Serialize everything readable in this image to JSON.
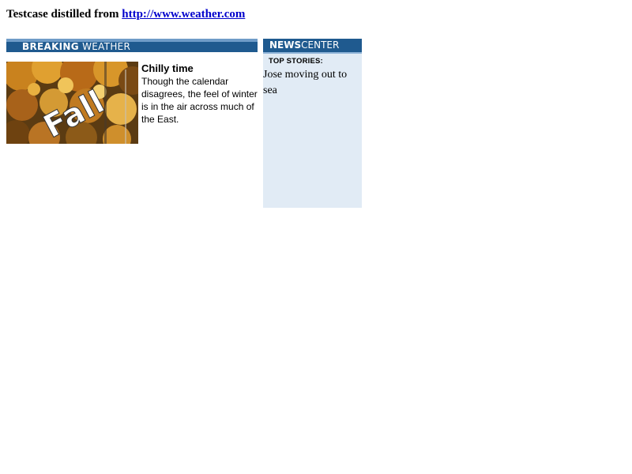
{
  "header": {
    "prefix": "Testcase distilled from ",
    "link_text": "http://www.weather.com"
  },
  "breaking": {
    "banner_strong": "BREAKING",
    "banner_light": "WEATHER",
    "image_icon": "fall-foliage-photo",
    "image_text": "Fall",
    "story_title": "Chilly time",
    "story_body": "Though the calendar disagrees, the feel of winter is in the air across much of the East."
  },
  "news_center": {
    "banner_strong": "NEWS",
    "banner_light": "CENTER",
    "subhead": "TOP STORIES:",
    "items": [
      {
        "label": "Jose moving out to sea"
      }
    ]
  },
  "colors": {
    "banner_blue": "#1f5a8f",
    "panel_background": "#e1ebf5",
    "link": "#0000cc"
  }
}
